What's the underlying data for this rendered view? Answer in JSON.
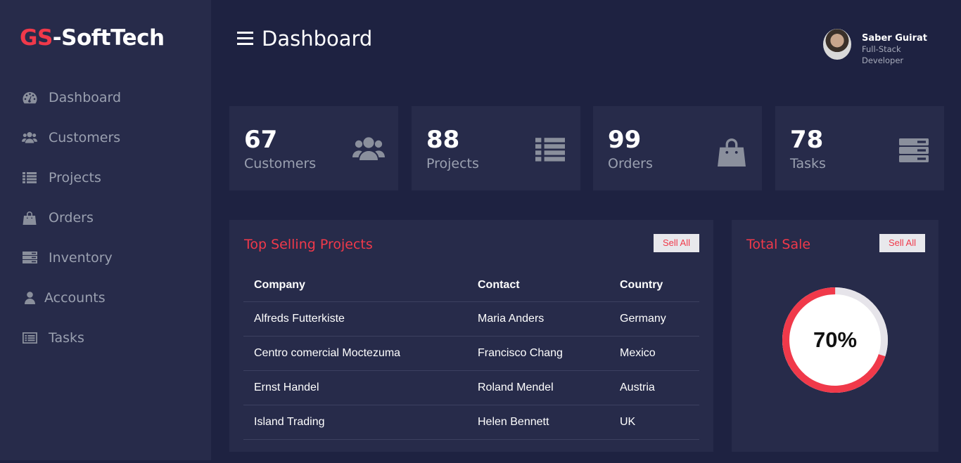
{
  "brand": {
    "prefix": "GS",
    "suffix": "-SoftTech",
    "accent": "#f0394a"
  },
  "sidebar": {
    "items": [
      {
        "label": "Dashboard",
        "icon": "dashboard-icon"
      },
      {
        "label": "Customers",
        "icon": "users-icon"
      },
      {
        "label": "Projects",
        "icon": "list-icon"
      },
      {
        "label": "Orders",
        "icon": "shopping-bag-icon"
      },
      {
        "label": "Inventory",
        "icon": "inventory-icon"
      },
      {
        "label": "Accounts",
        "icon": "user-icon"
      },
      {
        "label": "Tasks",
        "icon": "tasks-icon"
      }
    ]
  },
  "header": {
    "title": "Dashboard",
    "menu_icon": "hamburger-icon"
  },
  "user": {
    "name": "Saber Guirat",
    "role": "Full-Stack Developer"
  },
  "stats": [
    {
      "value": "67",
      "label": "Customers",
      "icon": "users-icon"
    },
    {
      "value": "88",
      "label": "Projects",
      "icon": "list-icon"
    },
    {
      "value": "99",
      "label": "Orders",
      "icon": "shopping-bag-icon"
    },
    {
      "value": "78",
      "label": "Tasks",
      "icon": "server-icon"
    }
  ],
  "top_selling": {
    "title": "Top Selling Projects",
    "button": "Sell All",
    "columns": [
      "Company",
      "Contact",
      "Country"
    ],
    "rows": [
      [
        "Alfreds Futterkiste",
        "Maria Anders",
        "Germany"
      ],
      [
        "Centro comercial Moctezuma",
        "Francisco Chang",
        "Mexico"
      ],
      [
        "Ernst Handel",
        "Roland Mendel",
        "Austria"
      ],
      [
        "Island Trading",
        "Helen Bennett",
        "UK"
      ]
    ]
  },
  "total_sale": {
    "title": "Total Sale",
    "button": "Sell All",
    "percent_label": "70%",
    "percent": 70,
    "fill_color": "#f0394a",
    "track_color": "#e6e4ea"
  }
}
